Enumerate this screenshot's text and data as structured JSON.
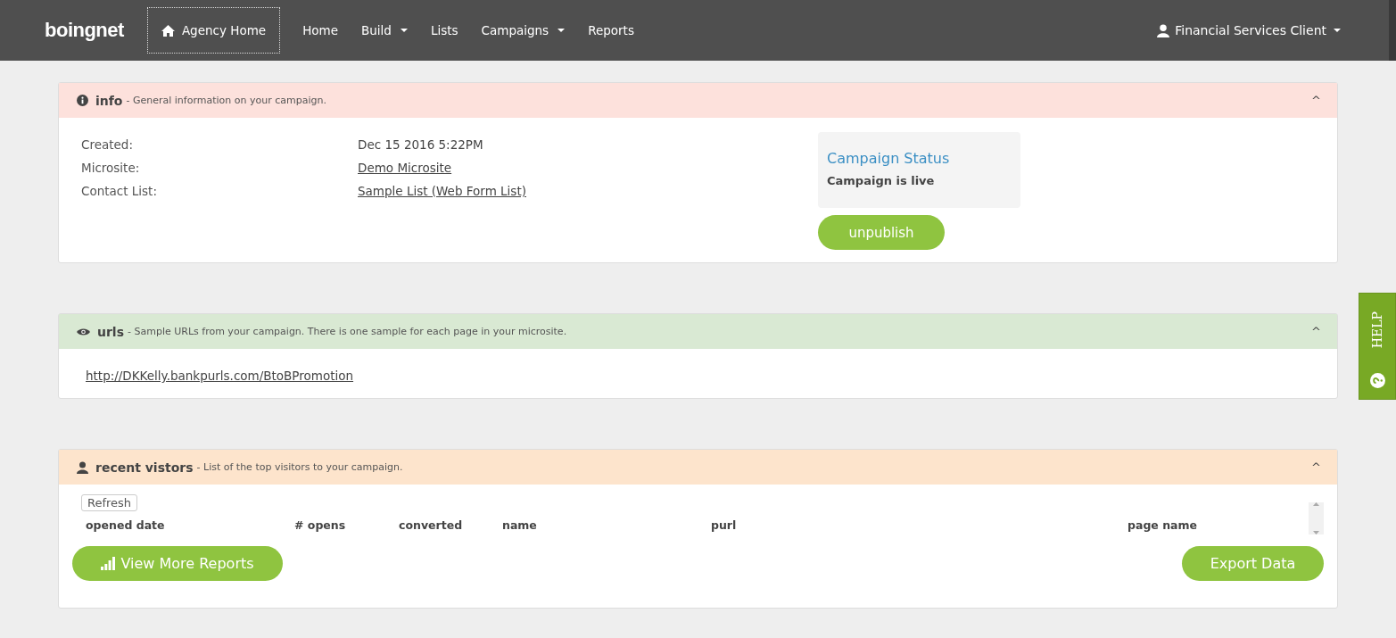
{
  "navbar": {
    "logo": "boingnet",
    "items": [
      {
        "label": "Agency Home",
        "kind": "home",
        "selected": true
      },
      {
        "label": "Home",
        "kind": "link",
        "selected": false
      },
      {
        "label": "Build",
        "kind": "dropdown",
        "selected": false
      },
      {
        "label": "Lists",
        "kind": "link",
        "selected": false
      },
      {
        "label": "Campaigns",
        "kind": "dropdown",
        "selected": false
      },
      {
        "label": "Reports",
        "kind": "link",
        "selected": false
      }
    ],
    "user": {
      "label": "Financial Services Client"
    }
  },
  "panels": [
    {
      "kind": "info",
      "title": "info",
      "description": "- General information on your campaign.",
      "color": "#fde1dc",
      "toggle": "^",
      "fields": [
        {
          "label": "Created:",
          "value": "Dec 15 2016 5:22PM",
          "link": false
        },
        {
          "label": "Microsite:",
          "value": "Demo Microsite",
          "link": true
        },
        {
          "label": "Contact List:",
          "value": "Sample List (Web Form List)",
          "link": true
        }
      ],
      "status": {
        "title": "Campaign Status",
        "text": "Campaign is live",
        "button": "unpublish"
      }
    },
    {
      "kind": "urls",
      "title": "urls",
      "description": "- Sample URLs from your campaign. There is one sample for each page in your microsite.",
      "color": "#d9e9d3",
      "toggle": "^",
      "urls": [
        "http://DKKelly.bankpurls.com/BtoBPromotion"
      ]
    },
    {
      "kind": "visitors",
      "title": "recent vistors",
      "description": "- List of the top visitors to your campaign.",
      "color": "#fde4cc",
      "toggle": "^",
      "refresh": "Refresh",
      "columns": [
        "opened date",
        "# opens",
        "converted",
        "name",
        "purl",
        "page name"
      ],
      "buttons": {
        "left": "View More Reports",
        "right": "Export Data"
      }
    }
  ],
  "help_tab": {
    "label": "HELP"
  }
}
